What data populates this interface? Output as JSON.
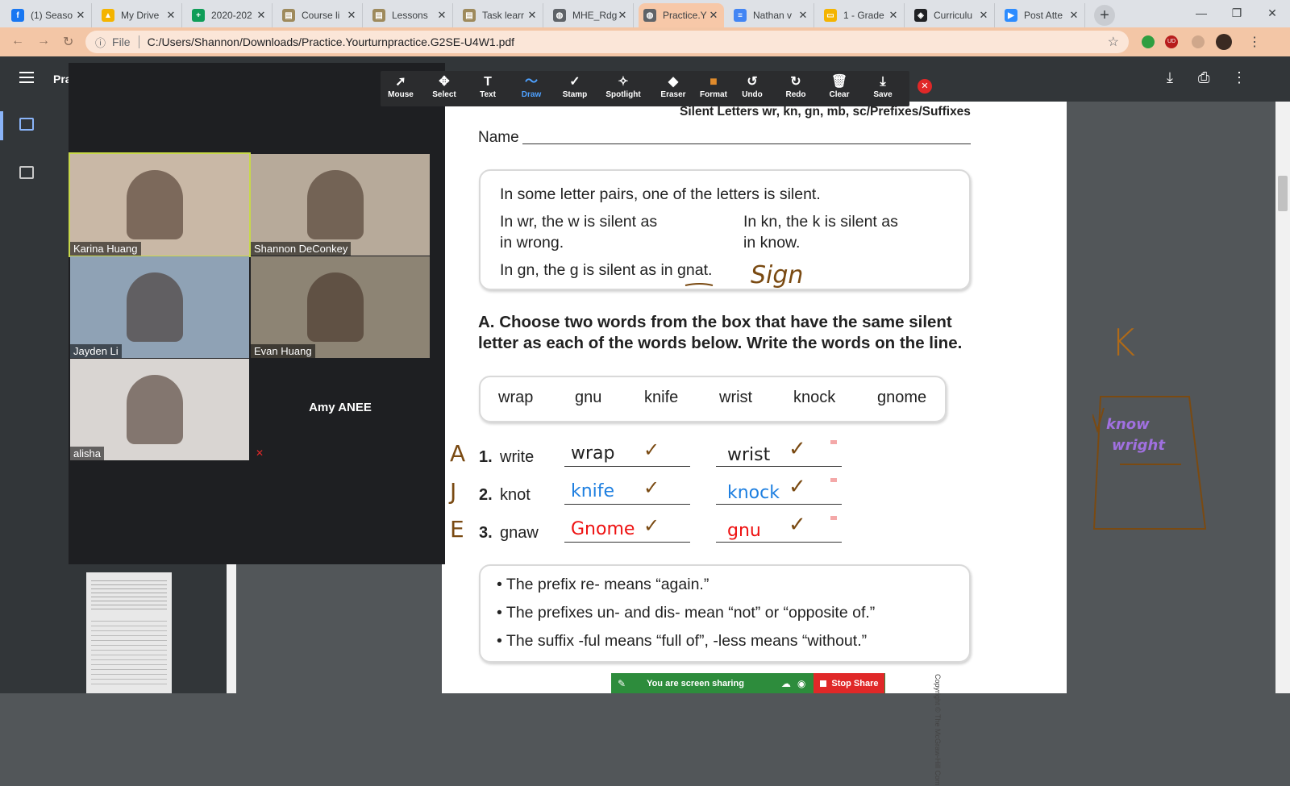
{
  "browser": {
    "tabs": [
      {
        "title": "(1) Seaso",
        "color": "#1877f2",
        "glyph": "f"
      },
      {
        "title": "My Drive",
        "color": "#f4b400",
        "glyph": "▲"
      },
      {
        "title": "2020-202",
        "color": "#0f9d58",
        "glyph": "+"
      },
      {
        "title": "Course li",
        "color": "#9e8a5c",
        "glyph": "▤"
      },
      {
        "title": "Lessons",
        "color": "#9e8a5c",
        "glyph": "▤"
      },
      {
        "title": "Task learr",
        "color": "#9e8a5c",
        "glyph": "▤"
      },
      {
        "title": "MHE_Rdg",
        "color": "#5f6368",
        "glyph": "◍"
      },
      {
        "title": "Practice.Y",
        "color": "#5f6368",
        "glyph": "◍"
      },
      {
        "title": "Nathan v",
        "color": "#4285f4",
        "glyph": "≡"
      },
      {
        "title": "1 - Grade",
        "color": "#f4b400",
        "glyph": "▭"
      },
      {
        "title": "Curriculu",
        "color": "#202124",
        "glyph": "◈"
      },
      {
        "title": "Post Atte",
        "color": "#2d8cff",
        "glyph": "▶"
      }
    ],
    "active_tab_index": 7,
    "url_scheme": "File",
    "url": "C:/Users/Shannon/Downloads/Practice.Yourturnpractice.G2SE-U4W1.pdf"
  },
  "pdf_viewer": {
    "title_fragment": "Pra"
  },
  "zoom": {
    "participants": [
      {
        "name": "Karina Huang",
        "bg": "#c9b8a6"
      },
      {
        "name": "Shannon DeConkey",
        "bg": "#b7aa9a"
      },
      {
        "name": "Jayden Li",
        "bg": "#8fa2b5"
      },
      {
        "name": "Evan Huang",
        "bg": "#8d8474"
      },
      {
        "name": "alisha",
        "bg": "#d9d5d2"
      },
      {
        "name": "Amy ANEE",
        "bg": "#1e1f22"
      }
    ],
    "annotate_tools": [
      {
        "label": "Mouse",
        "icon": "➚"
      },
      {
        "label": "Select",
        "icon": "✥"
      },
      {
        "label": "Text",
        "icon": "T"
      },
      {
        "label": "Draw",
        "icon": "〜"
      },
      {
        "label": "Stamp",
        "icon": "✓"
      },
      {
        "label": "Spotlight",
        "icon": "✧"
      },
      {
        "label": "Eraser",
        "icon": "◆"
      },
      {
        "label": "Format",
        "icon": "■"
      },
      {
        "label": "Undo",
        "icon": "↺"
      },
      {
        "label": "Redo",
        "icon": "↻"
      },
      {
        "label": "Clear",
        "icon": "🗑"
      },
      {
        "label": "Save",
        "icon": "⤓"
      }
    ],
    "active_tool": "Draw",
    "sharing_text": "You are screen sharing",
    "stop_share_label": "Stop Share"
  },
  "worksheet": {
    "header": "Silent Letters wr, kn, gn, mb, sc/Prefixes/Suffixes",
    "name_label": "Name",
    "rule_box": {
      "intro": "In some letter pairs, one of the letters is silent.",
      "wr_rule_1": "In wr, the w is silent as",
      "wr_rule_2": "in wrong.",
      "kn_rule_1": "In kn, the k is silent as",
      "kn_rule_2": "in know.",
      "gn_rule": "In gn, the g is silent as in gnat."
    },
    "instruction_1": "A. Choose two words from the box that have the same silent",
    "instruction_2": "letter as each of the words below. Write the words on the line.",
    "word_box": [
      "wrap",
      "gnu",
      "knife",
      "wrist",
      "knock",
      "gnome"
    ],
    "items": [
      {
        "num": "1.",
        "word": "write",
        "initial": "A",
        "answer1": "wrap",
        "answer2": "wrist",
        "color": "#222222"
      },
      {
        "num": "2.",
        "word": "knot",
        "initial": "J",
        "answer1": "knife",
        "answer2": "knock",
        "color": "#1e7fe0"
      },
      {
        "num": "3.",
        "word": "gnaw",
        "initial": "E",
        "answer1": "Gnome",
        "answer2": "gnu",
        "color": "#ee1111"
      }
    ],
    "prefix_box": [
      "The prefix re- means “again.”",
      "The prefixes un- and dis- mean “not” or “opposite of.”",
      "The suffix -ful means “full of”, -less means “without.”"
    ],
    "copyright": "Copyright © The McGraw-Hill Com",
    "handwritten_sign": "Sign",
    "margin_notes": {
      "letter": "K",
      "word1": "know",
      "word2": "wright"
    }
  },
  "colors": {
    "annotation_brown": "#7a4a12",
    "annotation_purple": "#a070e0",
    "zoom_green": "#2d8c3c",
    "stop_red": "#e02828"
  }
}
